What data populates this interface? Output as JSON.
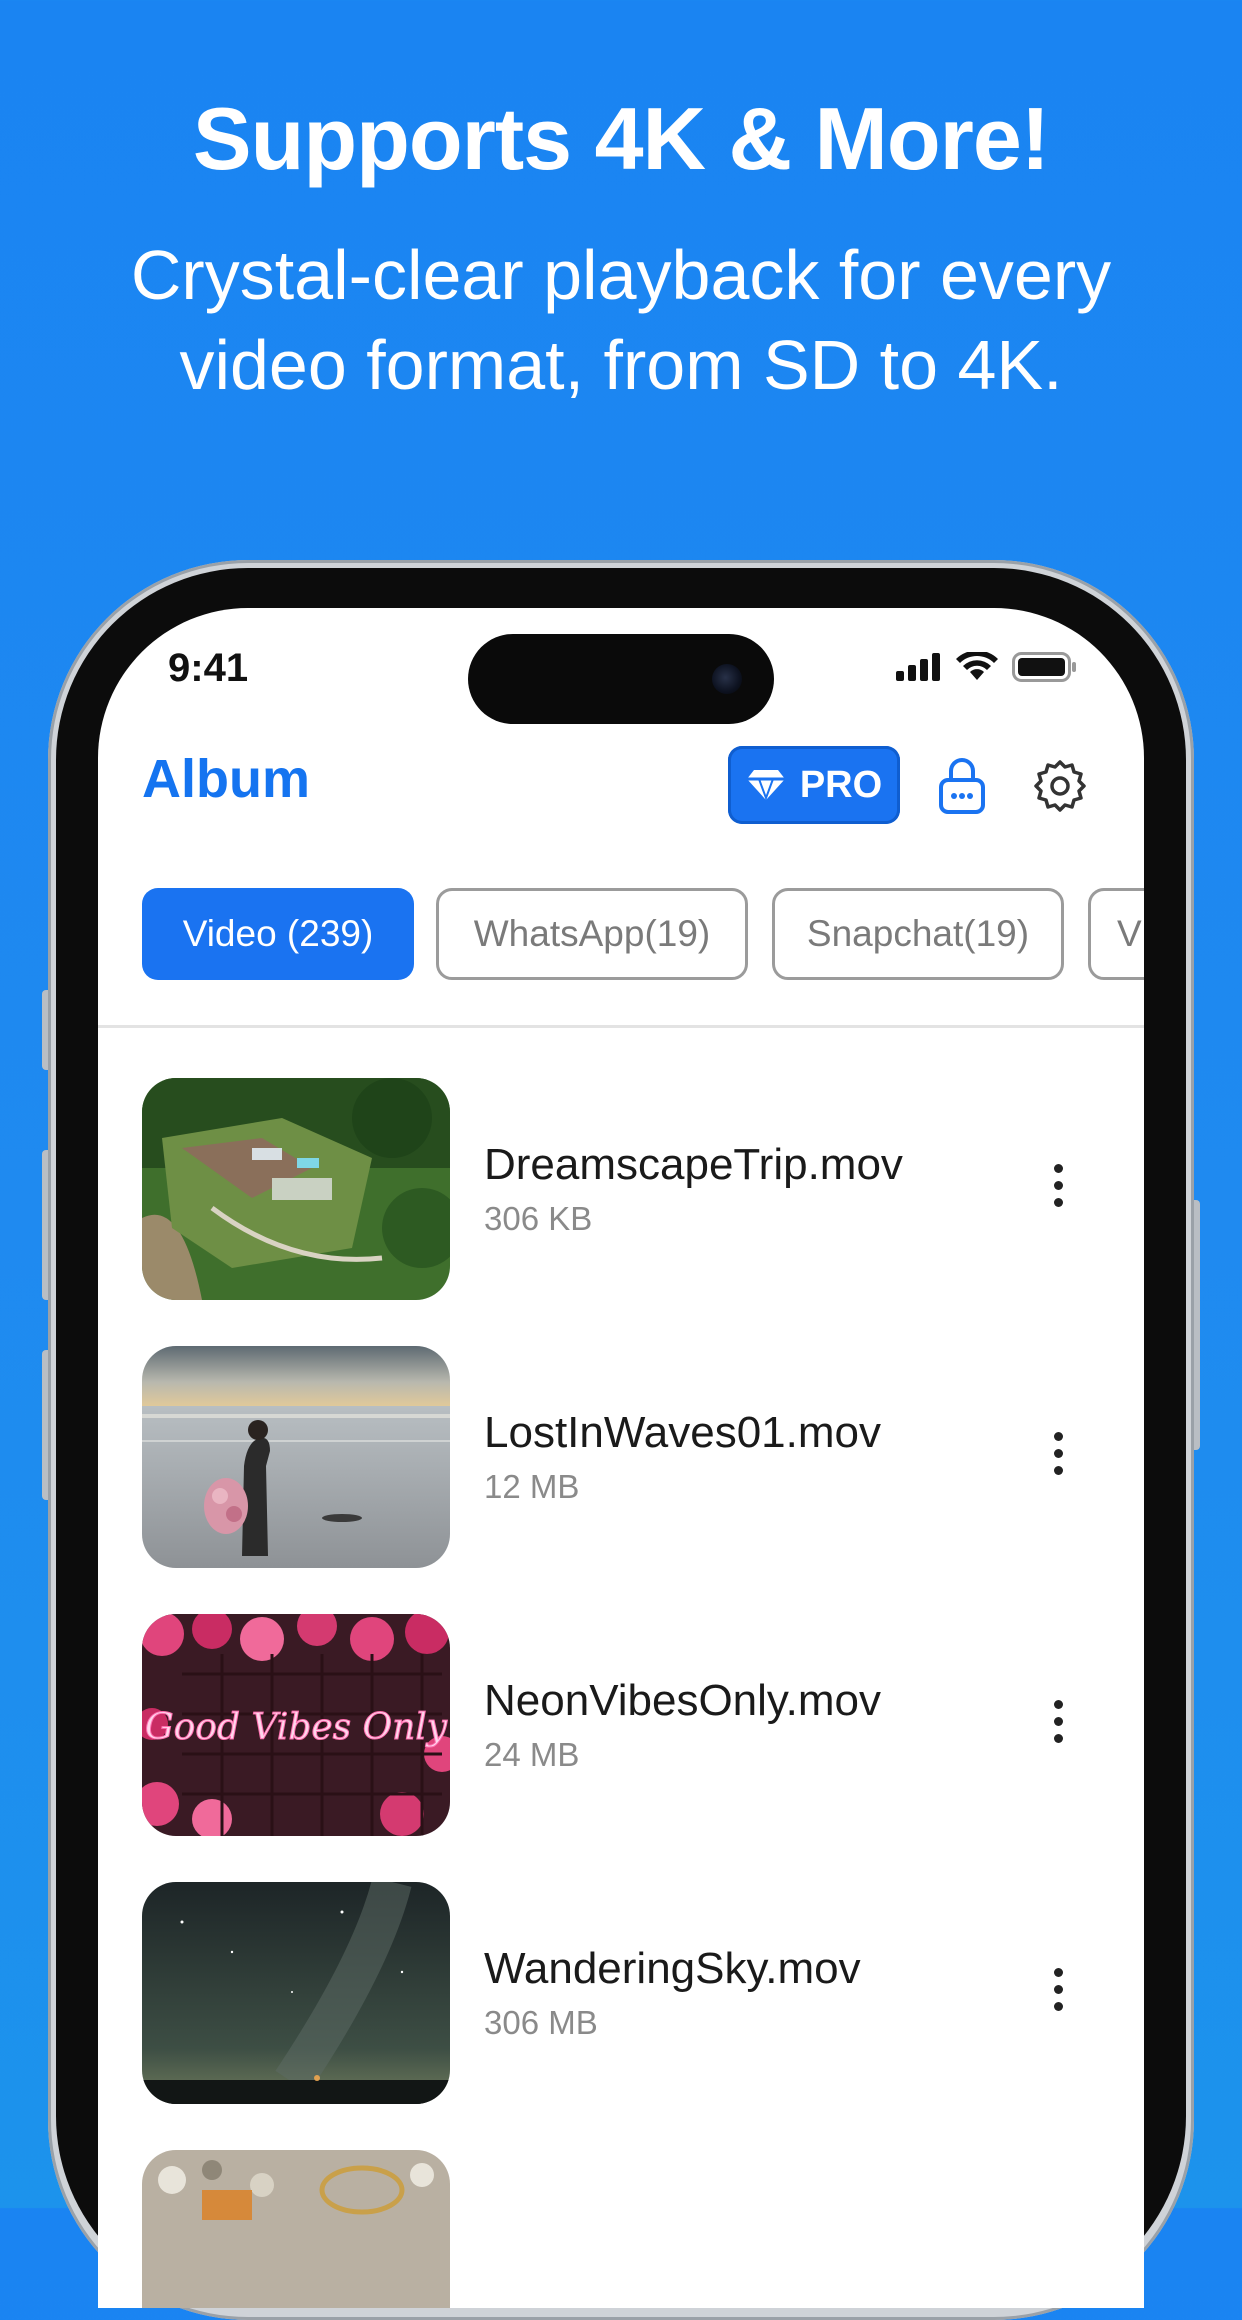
{
  "promo": {
    "headline": "Supports 4K & More!",
    "subtitle_line1": "Crystal-clear playback for every",
    "subtitle_line2": "video format, from SD to 4K."
  },
  "status_bar": {
    "time": "9:41",
    "icons": [
      "cellular-signal-icon",
      "wifi-icon",
      "battery-icon"
    ]
  },
  "header": {
    "title": "Album",
    "pro_label": "PRO",
    "pro_icon": "diamond-icon",
    "lock_icon": "lock-icon",
    "settings_icon": "gear-icon"
  },
  "chips": [
    {
      "label": "Video (239)",
      "active": true
    },
    {
      "label": "WhatsApp(19)",
      "active": false
    },
    {
      "label": "Snapchat(19)",
      "active": false
    },
    {
      "label": "V",
      "active": false
    }
  ],
  "videos": [
    {
      "name": "DreamscapeTrip.mov",
      "size": "306 KB"
    },
    {
      "name": "LostInWaves01.mov",
      "size": "12 MB"
    },
    {
      "name": "NeonVibesOnly.mov",
      "size": "24 MB"
    },
    {
      "name": "WanderingSky.mov",
      "size": "306 MB"
    }
  ],
  "thumbnail_neon_text": "Good Vibes Only",
  "colors": {
    "background": "#1a84f2",
    "accent": "#1a73f1",
    "title": "#1574f0"
  }
}
